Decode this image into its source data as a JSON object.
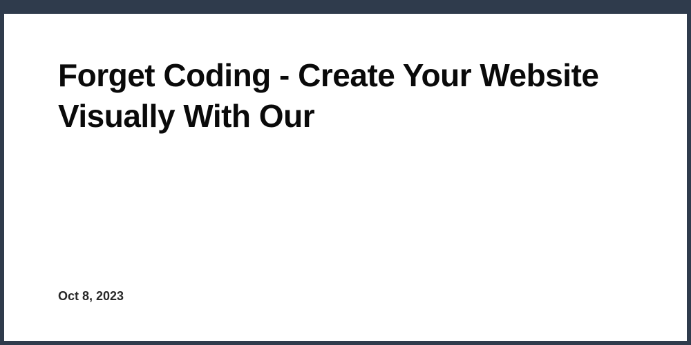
{
  "article": {
    "title": "Forget Coding - Create Your Website Visually With Our",
    "date": "Oct 8, 2023"
  }
}
